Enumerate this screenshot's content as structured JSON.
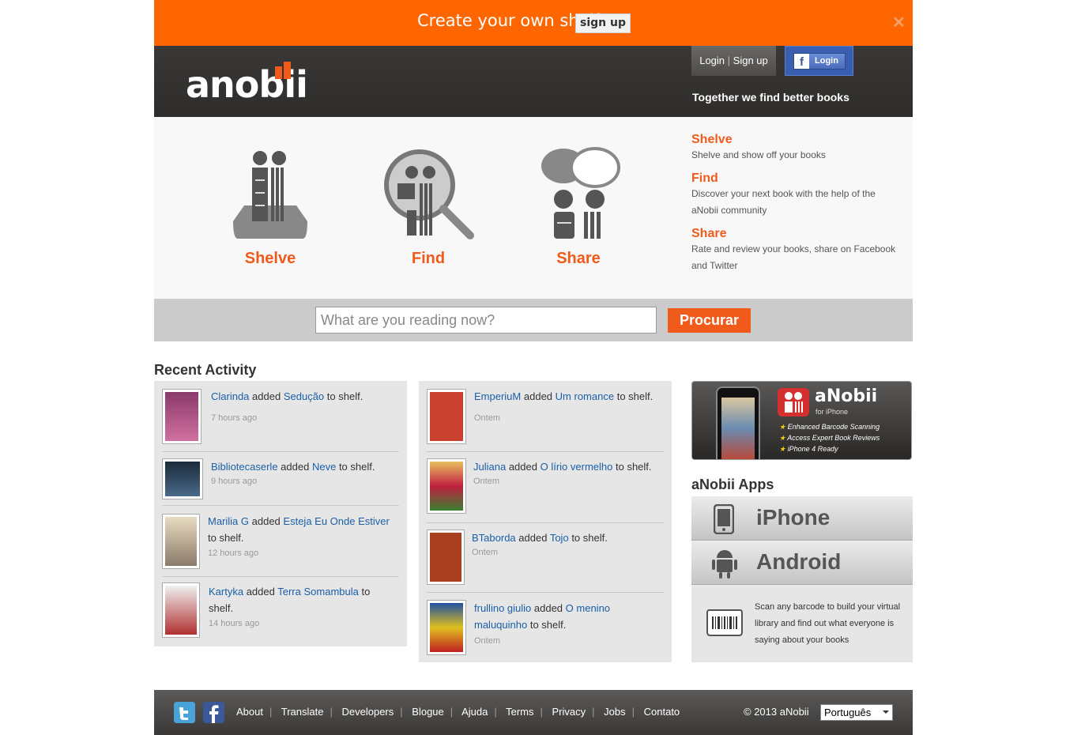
{
  "promo": {
    "text": "Create your own shelf",
    "button": "sign up",
    "close": "✕"
  },
  "header": {
    "logo": "anobii",
    "login": "Login",
    "signup": "Sign up",
    "separator": "|",
    "fb_login": "Login",
    "tagline": "Together we find better books"
  },
  "features": {
    "labels": [
      "Shelve",
      "Find",
      "Share"
    ],
    "list": [
      {
        "title": "Shelve",
        "desc": "Shelve and show off your books"
      },
      {
        "title": "Find",
        "desc": "Discover your next book with the help of the aNobii community"
      },
      {
        "title": "Share",
        "desc": "Rate and review your books, share on Facebook and Twitter"
      }
    ]
  },
  "search": {
    "placeholder": "What are you reading now?",
    "button": "Procurar"
  },
  "recent": {
    "title": "Recent Activity",
    "added": "added",
    "to_shelf": "to shelf.",
    "col1": [
      {
        "user": "Clarinda",
        "book": "Sedução",
        "time": "7 hours ago"
      },
      {
        "user": "Bibliotecaserle",
        "book": "Neve",
        "time": "9 hours ago"
      },
      {
        "user": "Marilia G",
        "book": "Esteja Eu Onde Estiver",
        "time": "12 hours ago"
      },
      {
        "user": "Kartyka",
        "book": "Terra Somambula",
        "time": "14 hours ago"
      }
    ],
    "col2": [
      {
        "user": "EmperiuM",
        "book": "Um romance",
        "time": "Ontem"
      },
      {
        "user": "Juliana",
        "book": "O lírio vermelho",
        "time": "Ontem"
      },
      {
        "user": "BTaborda",
        "book": "Tojo",
        "time": "Ontem"
      },
      {
        "user": "frullino giulio",
        "book": "O menino maluquinho",
        "time": "Ontem"
      }
    ]
  },
  "iphone_banner": {
    "name": "aNobii",
    "sub": "for iPhone",
    "features": [
      "Enhanced Barcode Scanning",
      "Access Expert Book Reviews",
      "iPhone 4 Ready"
    ]
  },
  "apps": {
    "title": "aNobii Apps",
    "iphone": "iPhone",
    "android": "Android",
    "scan_text": "Scan any barcode to build your virtual library and find out what everyone is saying about your books"
  },
  "footer": {
    "links": [
      "About",
      "Translate",
      "Developers",
      "Blogue",
      "Ajuda",
      "Terms",
      "Privacy",
      "Jobs",
      "Contato"
    ],
    "copyright": "© 2013 aNobii",
    "language": "Português"
  },
  "colors": {
    "accent": "#f05a1a",
    "promo": "#ff6600",
    "link": "#1a5fa8"
  }
}
